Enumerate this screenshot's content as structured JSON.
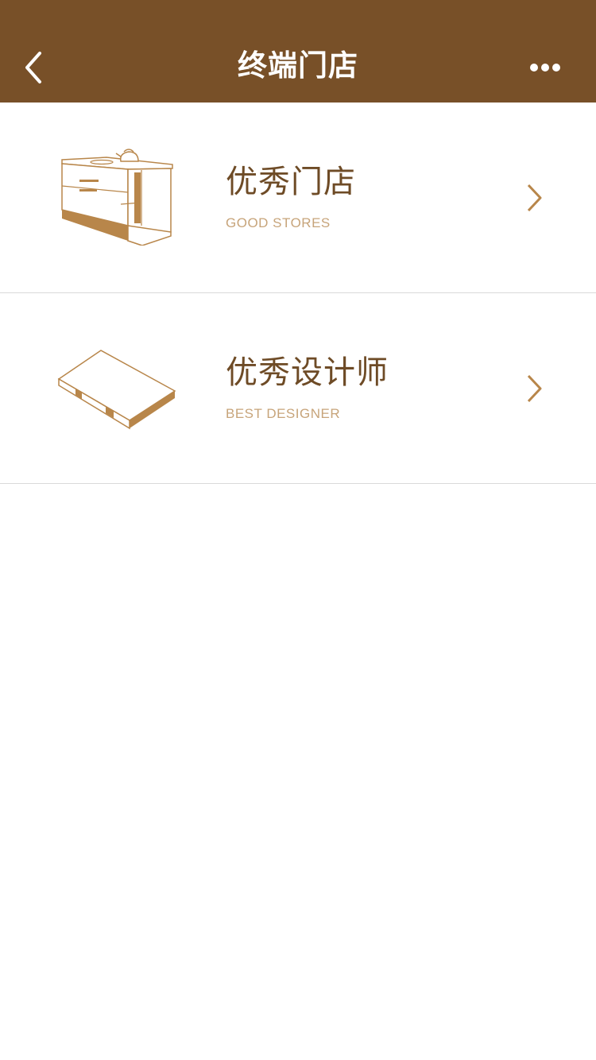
{
  "nav": {
    "title": "终端门店",
    "back_icon": "chevron-left-icon",
    "more_icon": "more-dots-icon"
  },
  "items": [
    {
      "title": "优秀门店",
      "subtitle": "GOOD STORES",
      "icon": "kitchen-cabinet-icon"
    },
    {
      "title": "优秀设计师",
      "subtitle": "BEST DESIGNER",
      "icon": "board-panel-icon"
    }
  ],
  "colors": {
    "nav_background": "#785028",
    "title_text": "#6e4b26",
    "subtitle_text": "#c7a47a",
    "accent": "#b8864a"
  }
}
